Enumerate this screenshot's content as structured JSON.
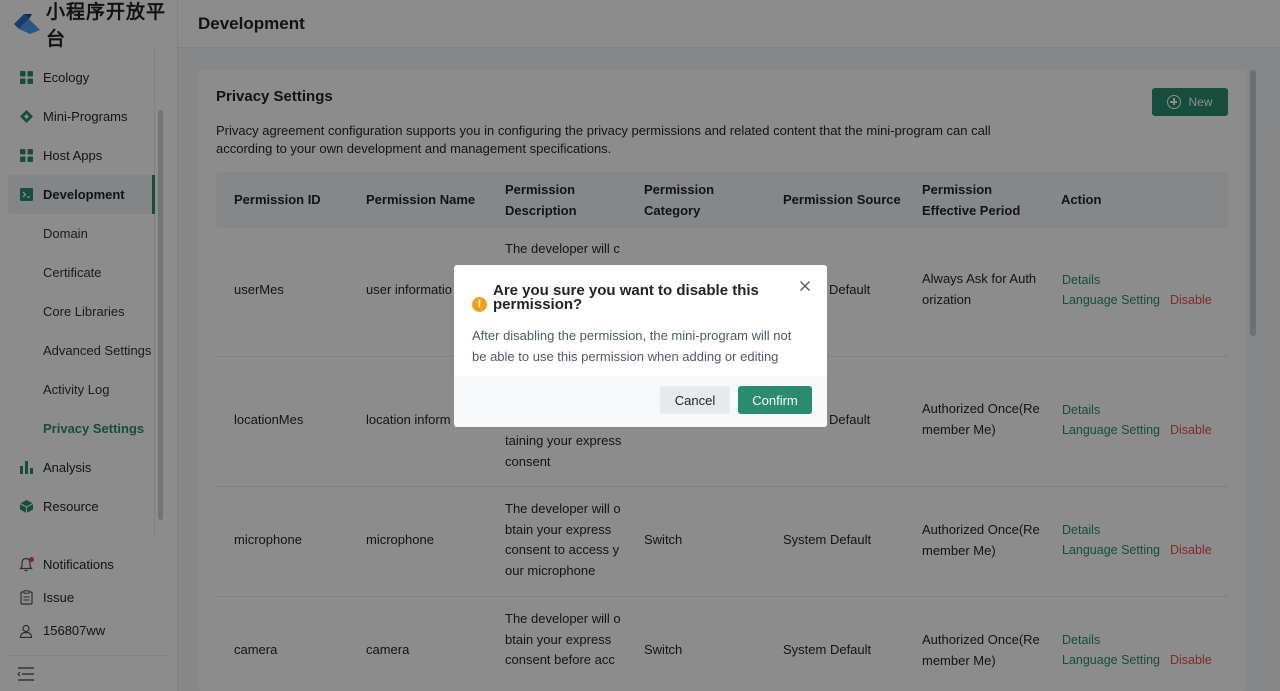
{
  "brand": {
    "name": "小程序开放平台",
    "accent": "#2a8c6f",
    "danger": "#e34d4d",
    "warning": "#f0a020"
  },
  "header": {
    "title": "Development"
  },
  "sidebar": {
    "items": [
      {
        "label": "Ecology",
        "icon": "grid-icon"
      },
      {
        "label": "Mini-Programs",
        "icon": "diamond-icon"
      },
      {
        "label": "Host Apps",
        "icon": "grid-icon"
      },
      {
        "label": "Development",
        "icon": "code-icon",
        "active": true
      },
      {
        "label": "Domain"
      },
      {
        "label": "Certificate"
      },
      {
        "label": "Core Libraries"
      },
      {
        "label": "Advanced Settings"
      },
      {
        "label": "Activity Log"
      },
      {
        "label": "Privacy Settings",
        "selected": true
      },
      {
        "label": "Analysis",
        "icon": "bar-chart-icon"
      },
      {
        "label": "Resource",
        "icon": "cube-icon"
      }
    ],
    "bottom": [
      {
        "label": "Notifications",
        "icon": "bell-icon"
      },
      {
        "label": "Issue",
        "icon": "clipboard-icon"
      },
      {
        "label": "156807ww",
        "icon": "user-icon"
      }
    ]
  },
  "main": {
    "title": "Privacy Settings",
    "new_label": "New",
    "description": "Privacy agreement configuration supports you in configuring the privacy permissions and related content that the mini-program can call according to your own development and management specifications.",
    "columns": [
      "Permission ID",
      "Permission Name",
      "Permission Description",
      "Permission Category",
      "Permission Source",
      "Permission Effective Period",
      "Action"
    ],
    "columns_wrapped": {
      "desc": [
        "Permission",
        "Description"
      ],
      "cat": [
        "Permission",
        "Category"
      ],
      "period": [
        "Permission",
        "Effective Period"
      ]
    },
    "rows": [
      {
        "id": "userMes",
        "name": "user informatio",
        "desc": [
          "The developer will c"
        ],
        "category": "",
        "source": "Default",
        "period": [
          "Always Ask for Auth",
          "orization"
        ]
      },
      {
        "id": "locationMes",
        "name": "location inform",
        "desc": [
          "taining your express",
          "consent"
        ],
        "category": "",
        "source": "Default",
        "period": [
          "Authorized Once(Re",
          "member Me)"
        ]
      },
      {
        "id": "microphone",
        "name": "microphone",
        "desc": [
          "The developer will o",
          "btain your express",
          "consent to access y",
          "our microphone"
        ],
        "category": "Switch",
        "source": "System Default",
        "period": [
          "Authorized Once(Re",
          "member Me)"
        ]
      },
      {
        "id": "camera",
        "name": "camera",
        "desc": [
          "The developer will o",
          "btain your express",
          "consent before acc"
        ],
        "category": "Switch",
        "source": "System Default",
        "period": [
          "Authorized Once(Re",
          "member Me)"
        ]
      }
    ],
    "actions": {
      "details": "Details",
      "language": "Language Setting",
      "disable": "Disable"
    }
  },
  "modal": {
    "title": "Are you sure you want to disable this permission?",
    "title_lines": [
      "Are you sure you want to disable this",
      "permission?"
    ],
    "body_lines": [
      "After disabling the permission, the mini-program will not",
      "be able to use this permission when adding or editing"
    ],
    "cancel": "Cancel",
    "confirm": "Confirm",
    "warning_glyph": "!"
  }
}
